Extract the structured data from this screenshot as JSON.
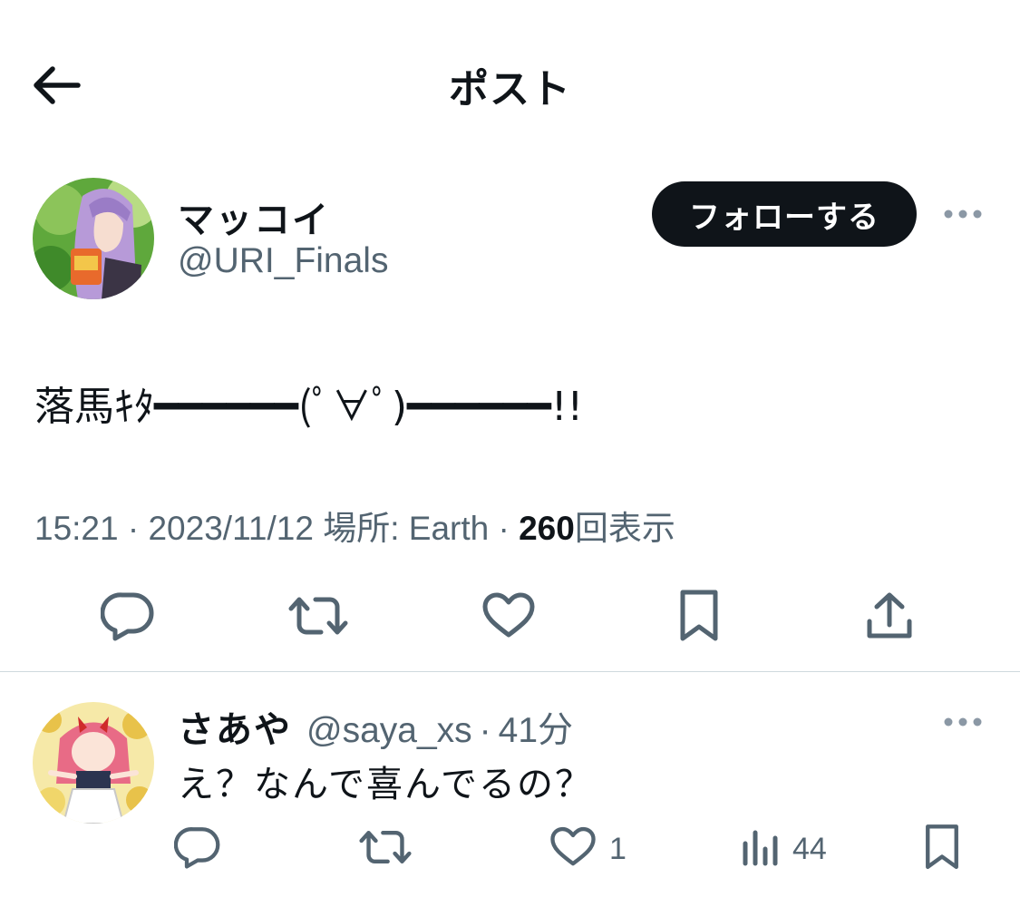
{
  "header": {
    "title": "ポスト",
    "back_icon": "arrow-left-icon"
  },
  "post": {
    "author": {
      "name": "マッコイ",
      "handle": "@URI_Finals"
    },
    "follow_label": "フォローする",
    "more_icon": "more-horizontal-icon",
    "text": "落馬ｷﾀ━━━━━━(ﾟ∀ﾟ)━━━━━━!!",
    "meta": {
      "time": "15:21",
      "date": "2023/11/12",
      "location": "場所: Earth",
      "views_count": "260",
      "views_label": "回表示",
      "separator": "·"
    },
    "actions": [
      "reply-icon",
      "retweet-icon",
      "like-icon",
      "bookmark-icon",
      "share-icon"
    ]
  },
  "reply": {
    "name": "さあや",
    "handle": "@saya_xs",
    "time": "41分",
    "separator": "·",
    "text": "え？なんで喜んでるの？",
    "like_count": "1",
    "views_count": "44"
  },
  "colors": {
    "text": "#0f1419",
    "secondary": "#536471",
    "divider": "#cfd9de",
    "follow_bg": "#0f1419"
  }
}
